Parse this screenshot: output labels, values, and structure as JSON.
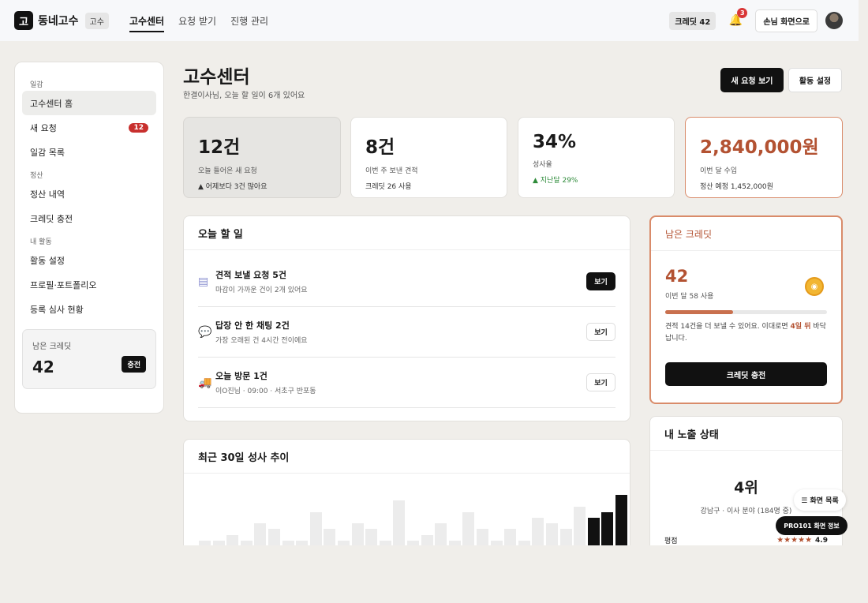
{
  "topbar": {
    "logo_char": "고",
    "brand": "동네고수",
    "role_badge": "고수",
    "nav": [
      "고수센터",
      "요청 받기",
      "진행 관리"
    ],
    "credit_pill": "크레딧 42",
    "notification_count": "3",
    "guest_button": "손님 화면으로"
  },
  "sidebar": {
    "sections": [
      {
        "title": "일감",
        "items": [
          {
            "label": "고수센터 홈",
            "active": true
          },
          {
            "label": "새 요청",
            "count": "12"
          },
          {
            "label": "일감 목록"
          }
        ]
      },
      {
        "title": "정산",
        "items": [
          {
            "label": "정산 내역"
          },
          {
            "label": "크레딧 충전"
          }
        ]
      },
      {
        "title": "내 활동",
        "items": [
          {
            "label": "활동 설정"
          },
          {
            "label": "프로필·포트폴리오"
          },
          {
            "label": "등록 심사 현황"
          }
        ]
      }
    ],
    "credit_box": {
      "label": "남은 크레딧",
      "value": "42",
      "button": "충전"
    }
  },
  "header": {
    "title": "고수센터",
    "subtitle": "한결이사님, 오늘 할 일이 6개 있어요",
    "primary_button": "새 요청 보기",
    "secondary_button": "활동 설정"
  },
  "stats": [
    {
      "value": "12건",
      "label": "오늘 들어온 새 요청",
      "note": "▲ 어제보다 3건 많아요"
    },
    {
      "value": "8건",
      "label": "이번 주 보낸 견적",
      "note": "크레딧 26 사용"
    },
    {
      "value": "34%",
      "label": "성사율",
      "note": "▲ 지난달 29%"
    },
    {
      "value": "2,840,000원",
      "label": "이번 달 수입",
      "note": "정산 예정 1,452,000원"
    }
  ],
  "todo": {
    "title": "오늘 할 일",
    "items": [
      {
        "icon": "document-icon",
        "title": "견적 보낼 요청 5건",
        "sub": "마감이 가까운 건이 2개 있어요",
        "button": "보기"
      },
      {
        "icon": "chat-icon",
        "title": "답장 안 한 채팅 2건",
        "sub": "가장 오래된 건 4시간 전이에요",
        "button": "보기"
      },
      {
        "icon": "truck-icon",
        "title": "오늘 방문 1건",
        "sub": "이O진님 · 09:00 · 서초구 반포동",
        "button": "보기"
      }
    ]
  },
  "trend": {
    "title": "최근 30일 성사 추이"
  },
  "chart_data": {
    "type": "bar",
    "title": "최근 30일 성사 추이",
    "values": [
      1,
      0,
      2,
      1,
      4,
      3,
      0,
      1,
      6,
      3,
      1,
      4,
      3,
      0,
      8,
      1,
      2,
      4,
      1,
      6,
      3,
      1,
      3,
      0,
      5,
      4,
      3,
      7,
      5,
      6,
      9
    ],
    "highlight_last": 3,
    "ylim": [
      0,
      10
    ]
  },
  "credit_panel": {
    "title": "남은 크레딧",
    "value": "42",
    "sub": "이번 달 58 사용",
    "usage_fraction": 0.42,
    "note_before": "견적 14건을 더 보낼 수 있어요. 이대로면 ",
    "note_bold": "4일 뒤",
    "note_after": " 바닥납니다.",
    "button": "크레딧 충전"
  },
  "exposure": {
    "title": "내 노출 상태",
    "rank": "4위",
    "sub": "강남구 · 이사 분야 (184명 중)",
    "rating_label": "평점",
    "stars": "★★★★★",
    "score": "4.9"
  },
  "floating": {
    "list_button": "☰ 화면 목록",
    "info_button": "PRO101 화면 정보"
  }
}
